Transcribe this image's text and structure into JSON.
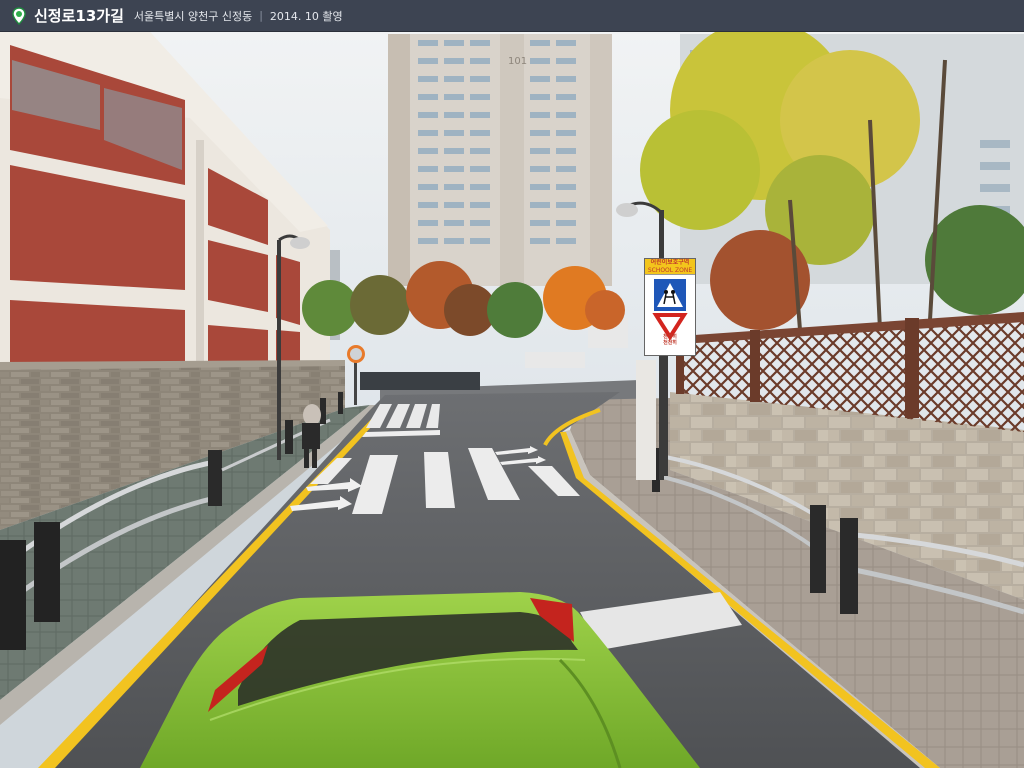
{
  "header": {
    "title": "신정로13가길",
    "address": "서울특별시 양천구 신정동",
    "separator": "|",
    "capture_date": "2014. 10 촬영"
  },
  "sign": {
    "line1": "어린이보호구역",
    "line2": "SCHOOL ZONE",
    "subtext": "천천히 천천히"
  },
  "building": {
    "number_left": "101",
    "number_right": "101"
  },
  "colors": {
    "header_bg": "#3d4452",
    "sky": "#e6ebef",
    "road": "#5b5d60",
    "car": "#8cc43c",
    "lane_yellow": "#f2c320"
  }
}
